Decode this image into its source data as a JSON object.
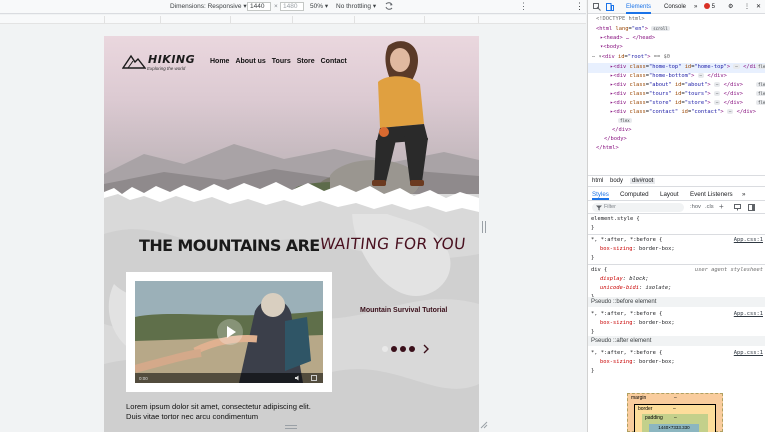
{
  "device_toolbar": {
    "dimensions_label": "Dimensions: Responsive ▾",
    "width": "1440",
    "times": "×",
    "height": "1480",
    "zoom": "50% ▾",
    "throttling": "No throttling ▾",
    "kebab": "⋮"
  },
  "site": {
    "brand": "HIKING",
    "tagline": "Exploring the world",
    "nav": [
      "Home",
      "About us",
      "Tours",
      "Store",
      "Contact"
    ],
    "headline_bold": "THE MOUNTAINS ARE",
    "headline_script": "WAITING FOR YOU",
    "video_time": "0:00",
    "tutorial_title": "Mountain Survival Tutorial",
    "lorem": "Lorem ipsum dolor sit amet, consectetur adipiscing elit. Duis vitae tortor nec arcu condimentum"
  },
  "colors": {
    "accent_dark": "#3a0f1a",
    "script_color": "#4a1120",
    "devtools_blue": "#1a73e8"
  },
  "devtools": {
    "tabs": {
      "elements": "Elements",
      "console": "Console",
      "more": "»",
      "errors": "5",
      "gear": "⚙",
      "kebab": "⋮",
      "close": "✕"
    },
    "dom": {
      "doctype": "<!DOCTYPE html>",
      "html_open_tag": "html",
      "html_lang_attr": "lang",
      "html_lang_val": "\"en\"",
      "scroll_pill": "scroll",
      "head": "<head> … </head>",
      "body_open": "<body>",
      "root_div_tag": "div",
      "root_id_attr": "id",
      "root_id_val": "\"root\"",
      "root_eq": "== $0",
      "children": [
        {
          "cls": "\"home-top\"",
          "id": "\"home-top\"",
          "pill": "flex"
        },
        {
          "cls": "\"home-bottom\"",
          "id": "",
          "pill": ""
        },
        {
          "cls": "\"about\"",
          "id": "\"about\"",
          "pill": "flex"
        },
        {
          "cls": "\"tours\"",
          "id": "\"tours\"",
          "pill": "flex"
        },
        {
          "cls": "\"store\"",
          "id": "\"store\"",
          "pill": "flex"
        },
        {
          "cls": "\"contact\"",
          "id": "\"contact\"",
          "pill": ""
        }
      ],
      "flex_pill": "flex",
      "div_close": "</div>",
      "body_close": "</body>",
      "html_close": "</html>"
    },
    "breadcrumbs": [
      "html",
      "body",
      "div#root"
    ],
    "styles_tabs": [
      "Styles",
      "Computed",
      "Layout",
      "Event Listeners",
      "»"
    ],
    "filter_placeholder": "Filter",
    "filter_controls": [
      ":hov",
      ".cls",
      "+"
    ],
    "rules": {
      "element_style": "element.style {",
      "close_brace": "}",
      "universal_selector": "*, *:after, *:before {",
      "box_sizing_prop": "box-sizing",
      "box_sizing_val": ": border-box;",
      "app_css": "App.css:1",
      "div_selector": "div {",
      "ua_label": "user agent stylesheet",
      "display_prop": "display",
      "display_val": ": block;",
      "unicode_prop": "unicode-bidi",
      "unicode_val": ": isolate;",
      "pseudo_before": "Pseudo ::before element",
      "pseudo_after": "Pseudo ::after element"
    },
    "box_model": {
      "margin": "margin",
      "margin_val": "–",
      "border": "border",
      "border_val": "–",
      "padding": "padding",
      "padding_val": "–",
      "content": "1440×7333.330"
    }
  }
}
